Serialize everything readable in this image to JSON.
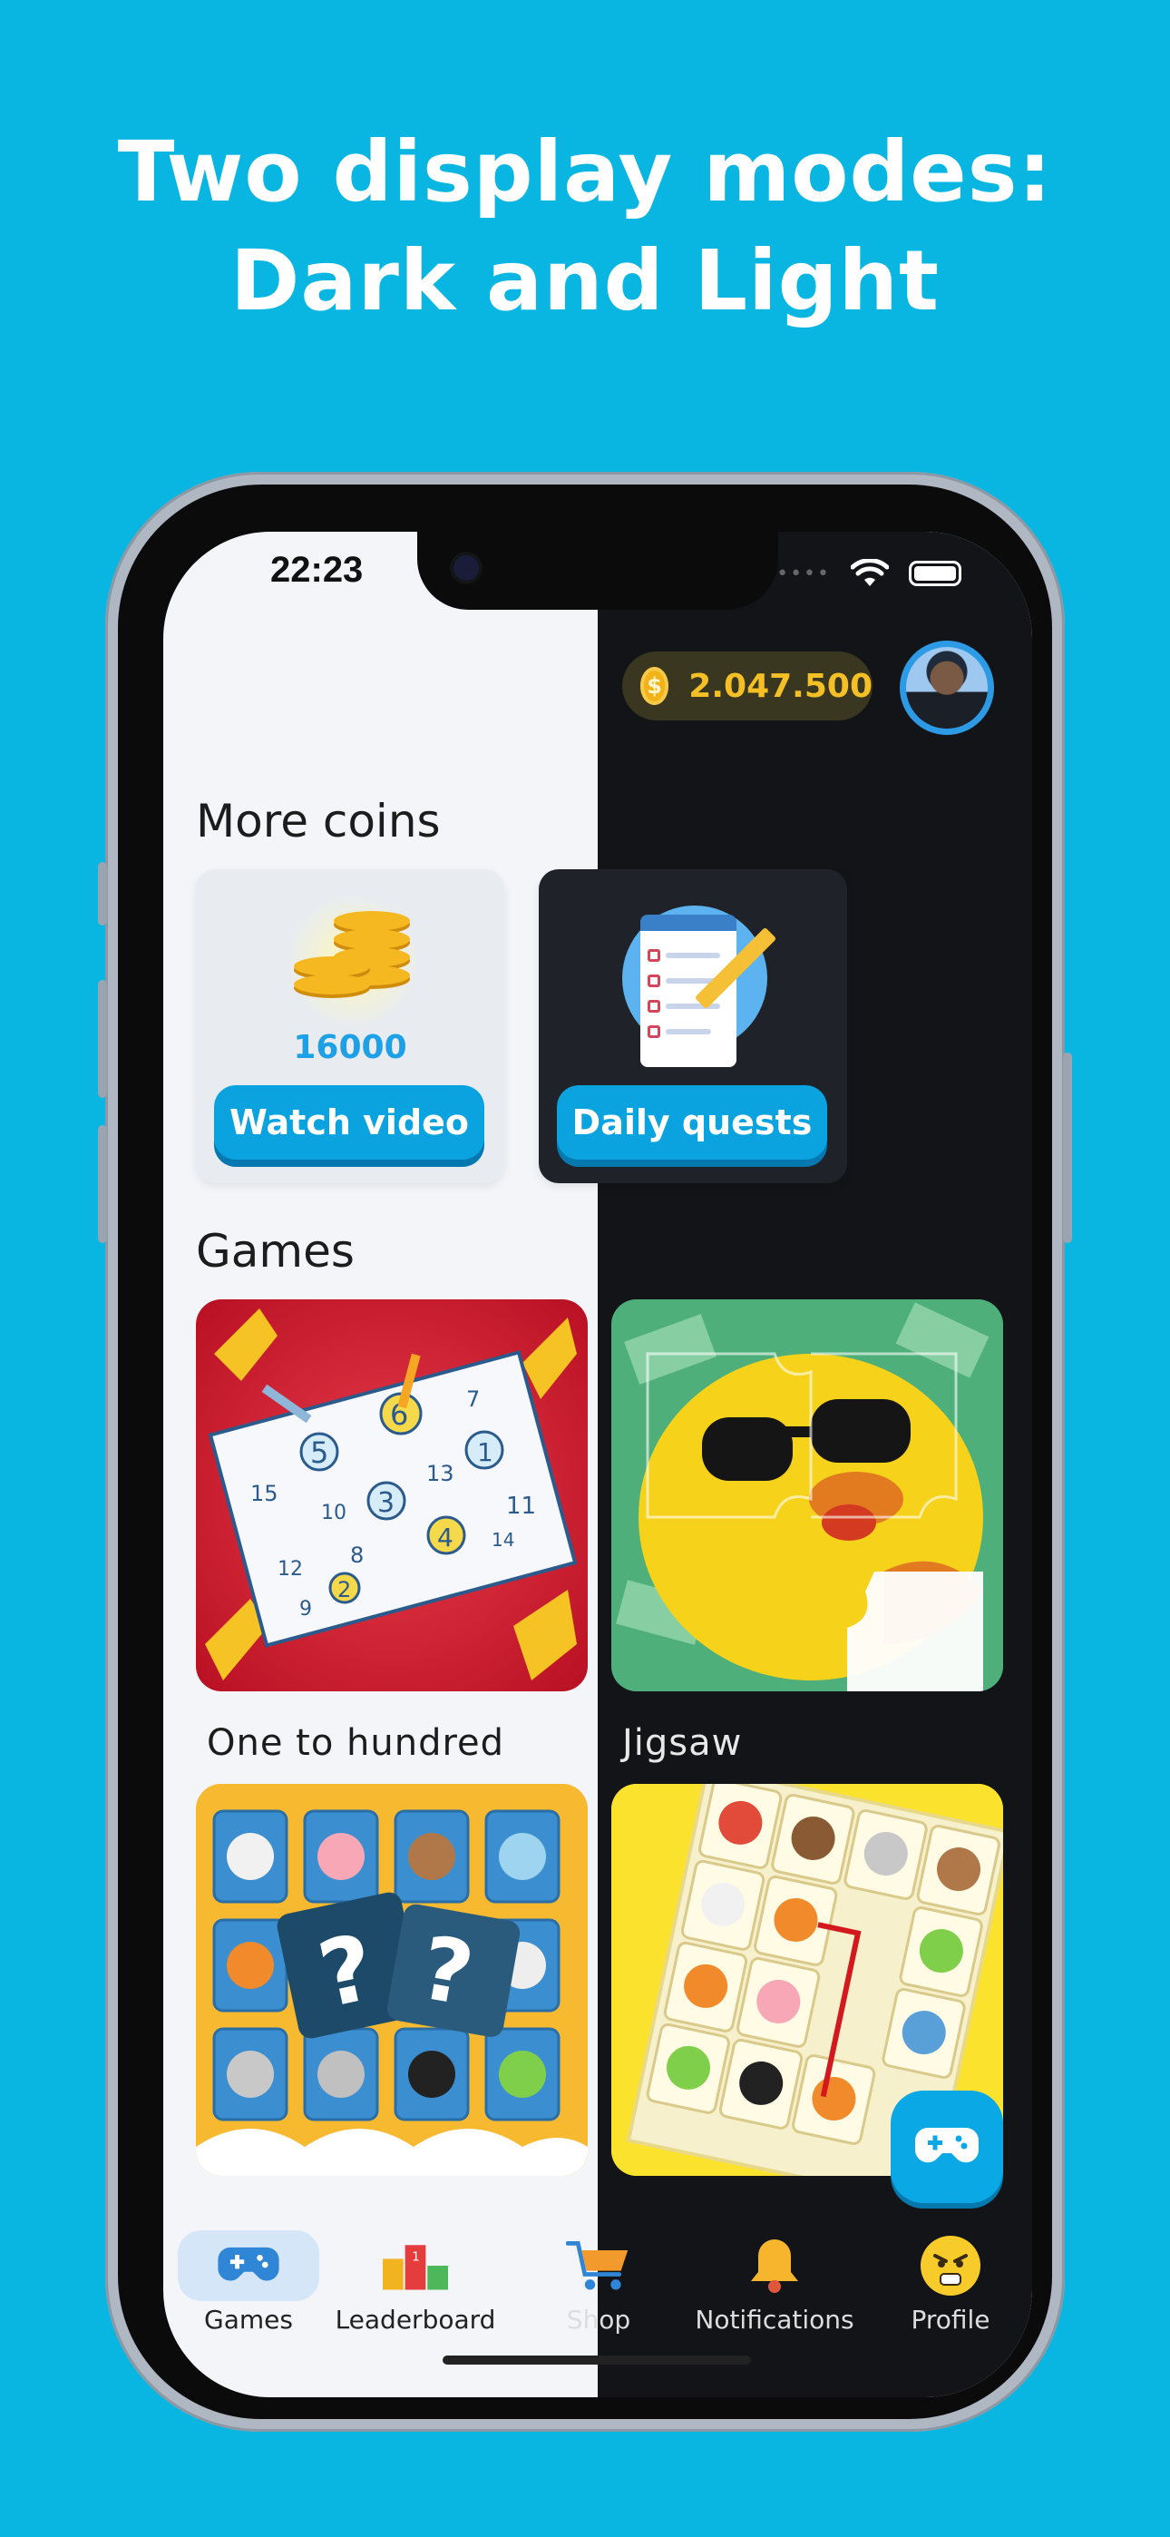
{
  "headline": {
    "line1": "Two display modes:",
    "line2": "Dark and Light"
  },
  "status_bar": {
    "time": "22:23"
  },
  "header": {
    "coins": "2.047.500",
    "coin_symbol": "$"
  },
  "more_coins": {
    "title": "More coins",
    "video_card": {
      "amount": "16000",
      "button": "Watch video"
    },
    "quests_card": {
      "button": "Daily quests"
    }
  },
  "games": {
    "title": "Games",
    "items": [
      {
        "label": "One to hundred"
      },
      {
        "label": "Jigsaw"
      },
      {
        "label": ""
      },
      {
        "label": ""
      }
    ],
    "one_to_hundred_numbers": [
      "5",
      "6",
      "7",
      "15",
      "10",
      "3",
      "13",
      "1",
      "11",
      "12",
      "8",
      "4",
      "14",
      "9",
      "2"
    ]
  },
  "tabbar": {
    "items": [
      {
        "label": "Games",
        "icon": "gamepad-icon",
        "active": true
      },
      {
        "label": "Leaderboard",
        "icon": "podium-icon"
      },
      {
        "label": "Shop",
        "icon": "cart-icon"
      },
      {
        "label": "Notifications",
        "icon": "bell-icon"
      },
      {
        "label": "Profile",
        "icon": "emoji-face-icon"
      }
    ]
  },
  "colors": {
    "background": "#09b6e2",
    "accent": "#0aa3e0",
    "coin": "#f4c025",
    "dark_bg": "#121418",
    "light_bg": "#f3f5f9"
  }
}
